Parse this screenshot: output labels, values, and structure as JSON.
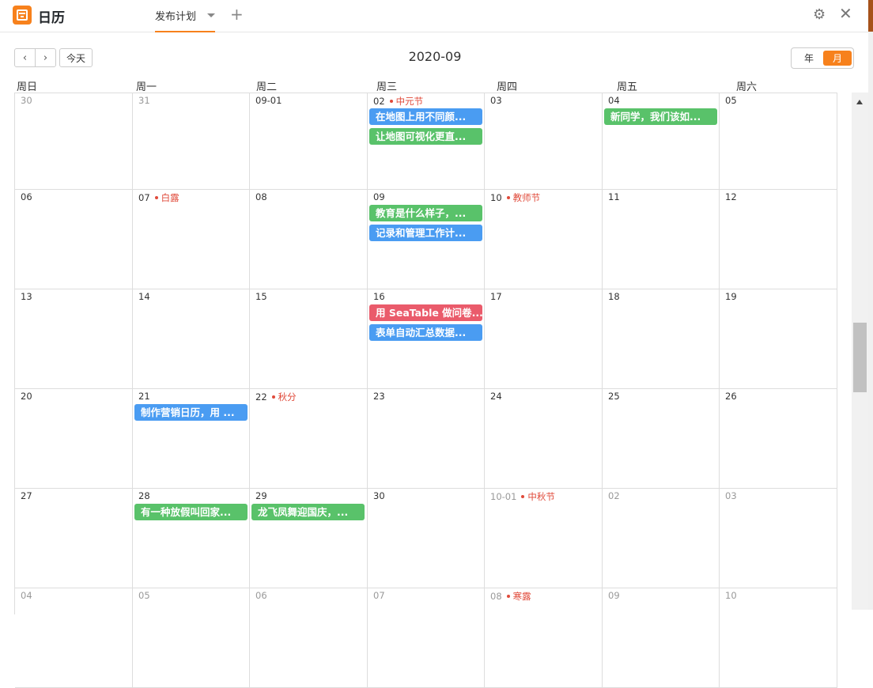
{
  "app": {
    "title": "日历",
    "icon": "calendar-icon",
    "accent": "#f7811c"
  },
  "tabs": [
    {
      "label": "发布计划",
      "active": true
    }
  ],
  "add_tab": "+",
  "toolbar": {
    "prev": "‹",
    "next": "›",
    "today": "今天",
    "title": "2020-09",
    "view_year": "年",
    "view_month": "月",
    "active_view": "月"
  },
  "weekdays": [
    "周日",
    "周一",
    "周二",
    "周三",
    "周四",
    "周五",
    "周六"
  ],
  "weeks": [
    {
      "days": [
        {
          "date": "30",
          "other": true
        },
        {
          "date": "31",
          "other": true
        },
        {
          "date": "09-01"
        },
        {
          "date": "02",
          "holiday": "中元节",
          "events": [
            {
              "title": "在地图上用不同颜...",
              "color": "blue"
            },
            {
              "title": "让地图可视化更直...",
              "color": "green"
            }
          ]
        },
        {
          "date": "03"
        },
        {
          "date": "04",
          "events": [
            {
              "title": "新同学，我们该如...",
              "color": "green"
            }
          ]
        },
        {
          "date": "05"
        }
      ]
    },
    {
      "days": [
        {
          "date": "06"
        },
        {
          "date": "07",
          "holiday": "白露"
        },
        {
          "date": "08"
        },
        {
          "date": "09",
          "events": [
            {
              "title": "教育是什么样子，...",
              "color": "green"
            },
            {
              "title": "记录和管理工作计...",
              "color": "blue"
            }
          ]
        },
        {
          "date": "10",
          "holiday": "教师节"
        },
        {
          "date": "11"
        },
        {
          "date": "12"
        }
      ]
    },
    {
      "days": [
        {
          "date": "13"
        },
        {
          "date": "14"
        },
        {
          "date": "15"
        },
        {
          "date": "16",
          "events": [
            {
              "title": "用 SeaTable 做问卷...",
              "color": "red"
            },
            {
              "title": "表单自动汇总数据...",
              "color": "blue"
            }
          ]
        },
        {
          "date": "17"
        },
        {
          "date": "18"
        },
        {
          "date": "19"
        }
      ]
    },
    {
      "days": [
        {
          "date": "20"
        },
        {
          "date": "21",
          "events": [
            {
              "title": "制作营销日历，用 ...",
              "color": "blue"
            }
          ]
        },
        {
          "date": "22",
          "holiday": "秋分"
        },
        {
          "date": "23"
        },
        {
          "date": "24"
        },
        {
          "date": "25"
        },
        {
          "date": "26"
        }
      ]
    },
    {
      "days": [
        {
          "date": "27"
        },
        {
          "date": "28",
          "events": [
            {
              "title": "有一种放假叫回家...",
              "color": "green"
            }
          ]
        },
        {
          "date": "29",
          "events": [
            {
              "title": "龙飞凤舞迎国庆，...",
              "color": "green"
            }
          ]
        },
        {
          "date": "30"
        },
        {
          "date": "10-01",
          "other": true,
          "holiday": "中秋节"
        },
        {
          "date": "02",
          "other": true
        },
        {
          "date": "03",
          "other": true
        }
      ]
    },
    {
      "days": [
        {
          "date": "04",
          "other": true
        },
        {
          "date": "05",
          "other": true
        },
        {
          "date": "06",
          "other": true
        },
        {
          "date": "07",
          "other": true
        },
        {
          "date": "08",
          "other": true,
          "holiday": "寒露"
        },
        {
          "date": "09",
          "other": true
        },
        {
          "date": "10",
          "other": true
        }
      ]
    }
  ]
}
